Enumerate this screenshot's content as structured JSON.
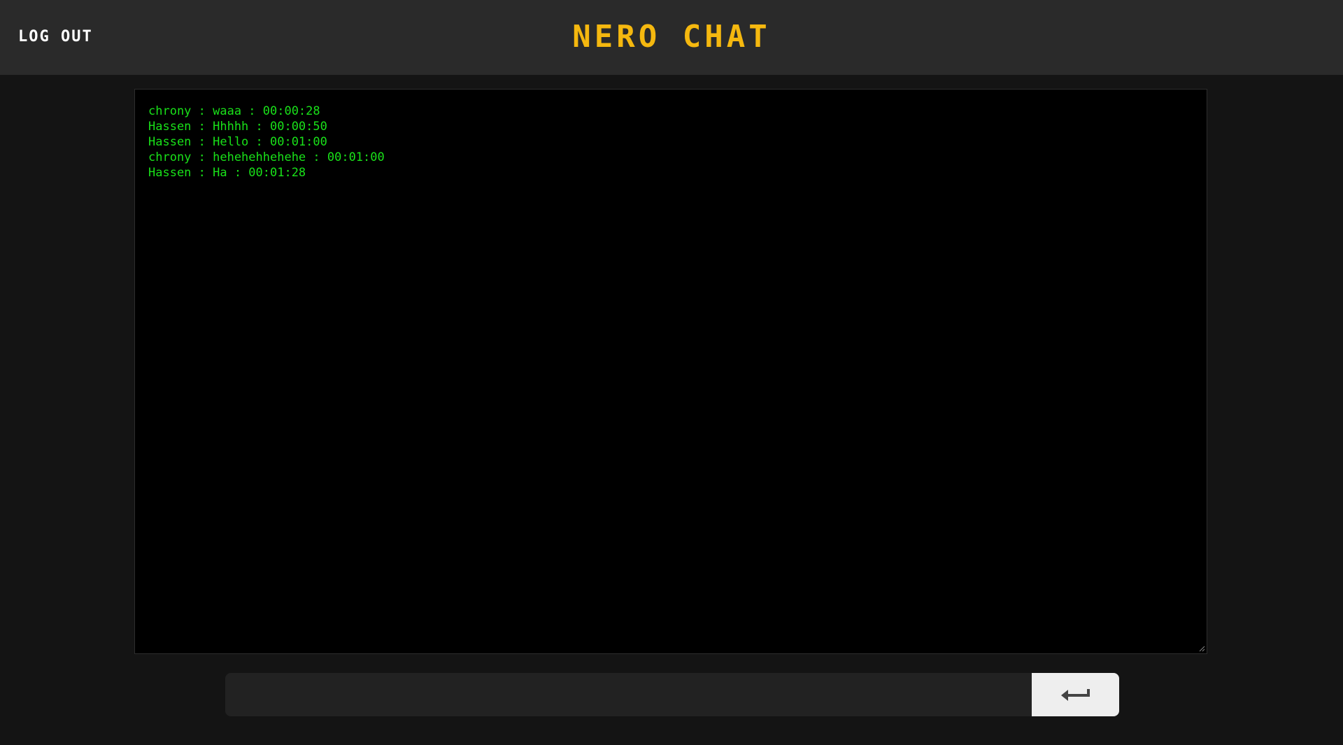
{
  "header": {
    "logout_label": "LOG OUT",
    "title": "NERO CHAT"
  },
  "chat": {
    "messages": [
      "chrony : waaa : 00:00:28",
      "Hassen : Hhhhh : 00:00:50",
      "Hassen : Hello : 00:01:00",
      "chrony : hehehehhehehe : 00:01:00",
      "Hassen : Ha : 00:01:28"
    ]
  },
  "composer": {
    "input_value": "",
    "send_icon": "enter-return-icon"
  },
  "colors": {
    "header_bg": "#2a2a2a",
    "page_bg": "#141414",
    "title": "#f5b80f",
    "message_text": "#19e119",
    "chat_bg": "#000000",
    "send_button_bg": "#eeeeee"
  }
}
